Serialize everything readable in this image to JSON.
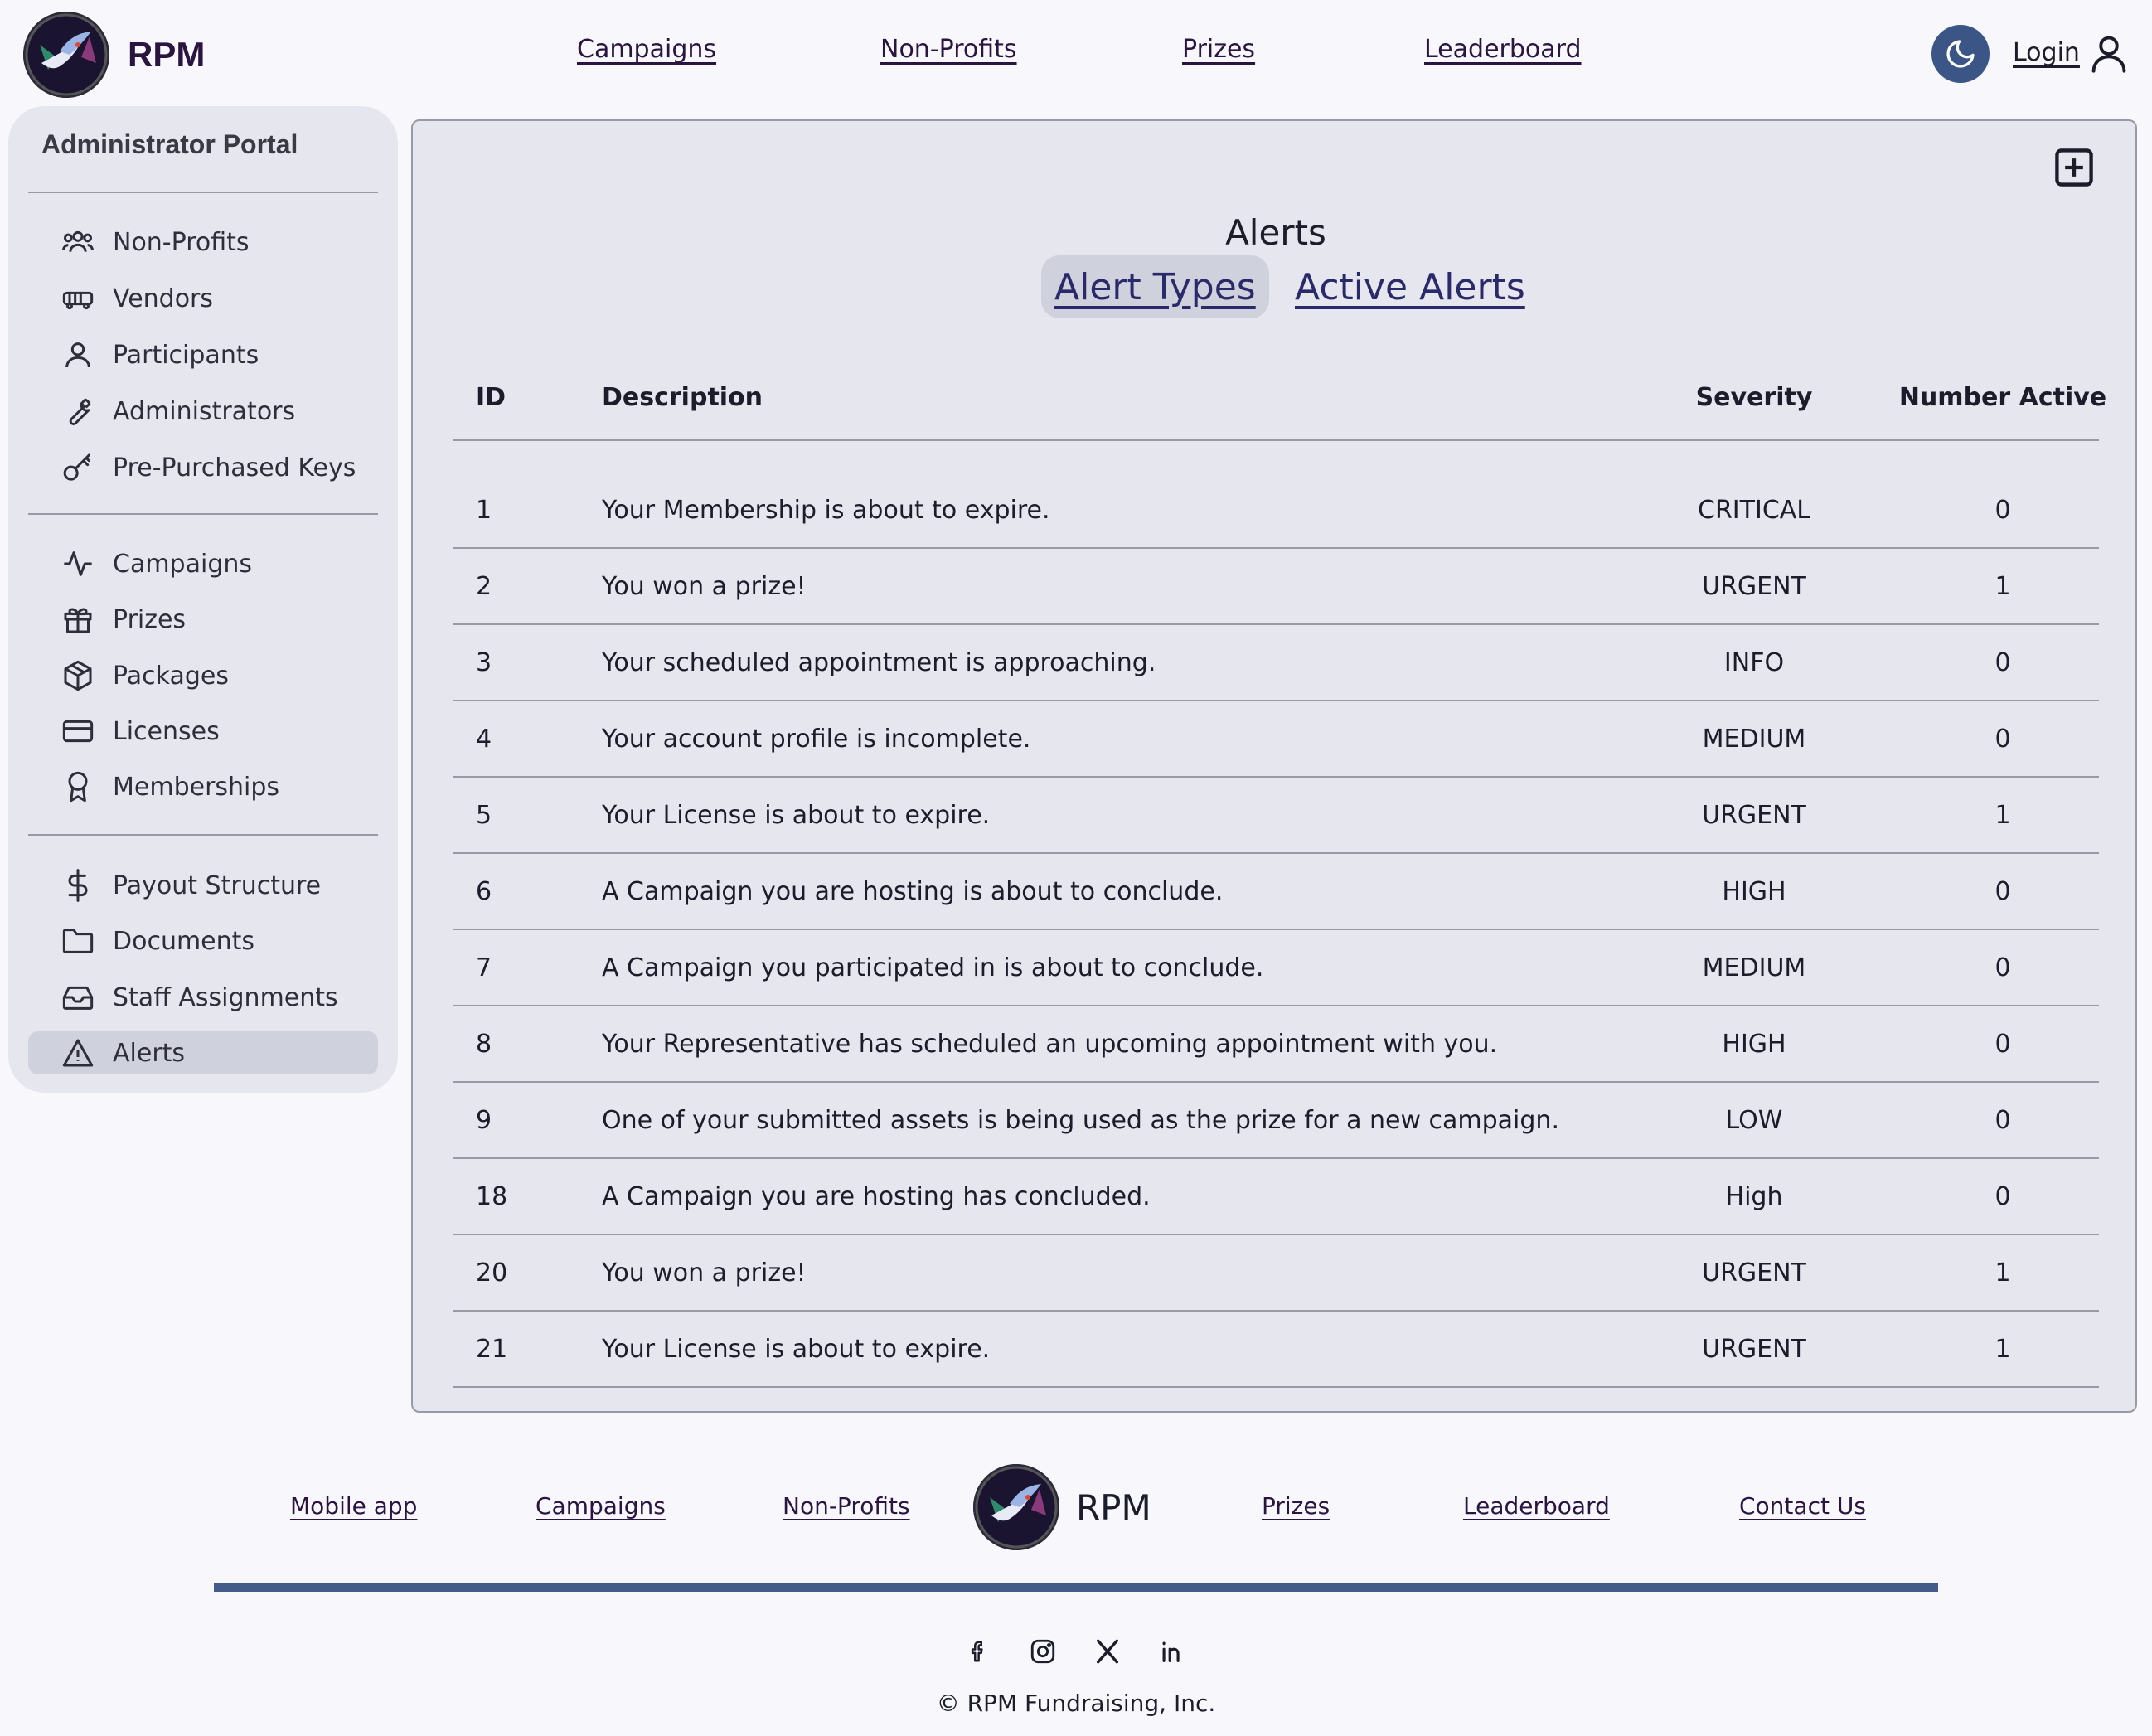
{
  "brand": "RPM",
  "header": {
    "nav": [
      "Campaigns",
      "Non-Profits",
      "Prizes",
      "Leaderboard"
    ],
    "login": "Login"
  },
  "sidebar": {
    "title": "Administrator Portal",
    "groups": [
      [
        {
          "label": "Non-Profits",
          "icon": "users-icon"
        },
        {
          "label": "Vendors",
          "icon": "truck-icon"
        },
        {
          "label": "Participants",
          "icon": "user-icon"
        },
        {
          "label": "Administrators",
          "icon": "wrench-icon"
        },
        {
          "label": "Pre-Purchased Keys",
          "icon": "key-icon"
        }
      ],
      [
        {
          "label": "Campaigns",
          "icon": "activity-icon"
        },
        {
          "label": "Prizes",
          "icon": "gift-icon"
        },
        {
          "label": "Packages",
          "icon": "box-icon"
        },
        {
          "label": "Licenses",
          "icon": "card-icon"
        },
        {
          "label": "Memberships",
          "icon": "award-icon"
        }
      ],
      [
        {
          "label": "Payout Structure",
          "icon": "dollar-icon"
        },
        {
          "label": "Documents",
          "icon": "folder-icon"
        },
        {
          "label": "Staff Assignments",
          "icon": "inbox-icon"
        },
        {
          "label": "Alerts",
          "icon": "alert-triangle-icon",
          "active": true
        }
      ]
    ]
  },
  "main": {
    "title": "Alerts",
    "tabs": [
      {
        "label": "Alert Types",
        "active": true
      },
      {
        "label": "Active Alerts",
        "active": false
      }
    ],
    "table": {
      "headers": [
        "ID",
        "Description",
        "Severity",
        "Number Active"
      ],
      "rows": [
        [
          "1",
          "Your Membership is about to expire.",
          "CRITICAL",
          "0"
        ],
        [
          "2",
          "You won a prize!",
          "URGENT",
          "1"
        ],
        [
          "3",
          "Your scheduled appointment is approaching.",
          "INFO",
          "0"
        ],
        [
          "4",
          "Your account profile is incomplete.",
          "MEDIUM",
          "0"
        ],
        [
          "5",
          "Your License is about to expire.",
          "URGENT",
          "1"
        ],
        [
          "6",
          "A Campaign you are hosting is about to conclude.",
          "HIGH",
          "0"
        ],
        [
          "7",
          "A Campaign you participated in is about to conclude.",
          "MEDIUM",
          "0"
        ],
        [
          "8",
          "Your Representative has scheduled an upcoming appointment with you.",
          "HIGH",
          "0"
        ],
        [
          "9",
          "One of your submitted assets is being used as the prize for a new campaign.",
          "LOW",
          "0"
        ],
        [
          "18",
          "A Campaign you are hosting has concluded.",
          "High",
          "0"
        ],
        [
          "20",
          "You won a prize!",
          "URGENT",
          "1"
        ],
        [
          "21",
          "Your License is about to expire.",
          "URGENT",
          "1"
        ]
      ]
    }
  },
  "footer": {
    "nav_left": [
      "Mobile app",
      "Campaigns",
      "Non-Profits"
    ],
    "nav_right": [
      "Prizes",
      "Leaderboard",
      "Contact Us"
    ],
    "socials": [
      "facebook-icon",
      "instagram-icon",
      "x-icon",
      "linkedin-icon"
    ],
    "copyright": "© RPM Fundraising, Inc."
  },
  "colors": {
    "accent": "#3b5586",
    "panel_bg": "#e6e7ee",
    "active_bg": "#cfd1dc",
    "divider": "#9a9aa6"
  }
}
